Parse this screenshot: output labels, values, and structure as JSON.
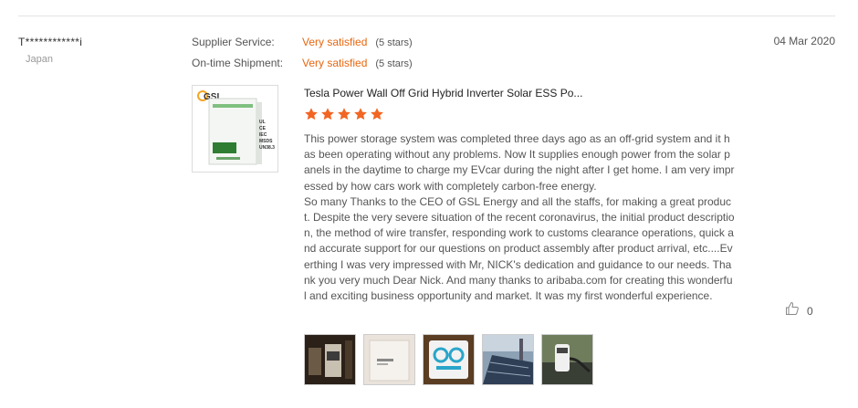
{
  "reviewer": {
    "name": "T************i",
    "country": "Japan"
  },
  "review_date": "04 Mar 2020",
  "ratings": [
    {
      "label": "Supplier Service:",
      "value": "Very satisfied",
      "stars_text": "(5 stars)"
    },
    {
      "label": "On-time Shipment:",
      "value": "Very satisfied",
      "stars_text": "(5 stars)"
    }
  ],
  "product": {
    "title": "Tesla Power Wall Off Grid Hybrid Inverter Solar ESS Po...",
    "rating": 5,
    "image_brand": "GSL",
    "image_labels": [
      "UL",
      "CE",
      "IEC",
      "MSDS",
      "UN38.3"
    ]
  },
  "review_paragraphs": [
    "This power storage system was completed three days ago as an off-grid system and  it has been operating without any problems. Now It supplies enough power from the solar panels in the daytime to charge my EVcar during the night after I get home. I am very impressed by how cars work with completely carbon-free energy.",
    "So many Thanks to the CEO of GSL Energy and all the staffs, for making a great product. Despite the very severe situation of the recent coronavirus, the initial product description, the method of wire transfer, responding work to customs clearance operations, quick and accurate support for our questions on product assembly after product arrival, etc....Everthing I was very impressed with Mr, NICK's dedication and guidance to our needs. Thank you very much Dear Nick. And many thanks to aribaba.com for creating this wonderful and exciting business opportunity and market. It was my first wonderful experience."
  ],
  "likes": {
    "count": "0"
  },
  "colors": {
    "accent": "#e8660f",
    "star": "#f26522",
    "divider": "#e3e3e3"
  },
  "icons": {
    "like": "thumbs-up-icon",
    "star": "star-icon"
  }
}
